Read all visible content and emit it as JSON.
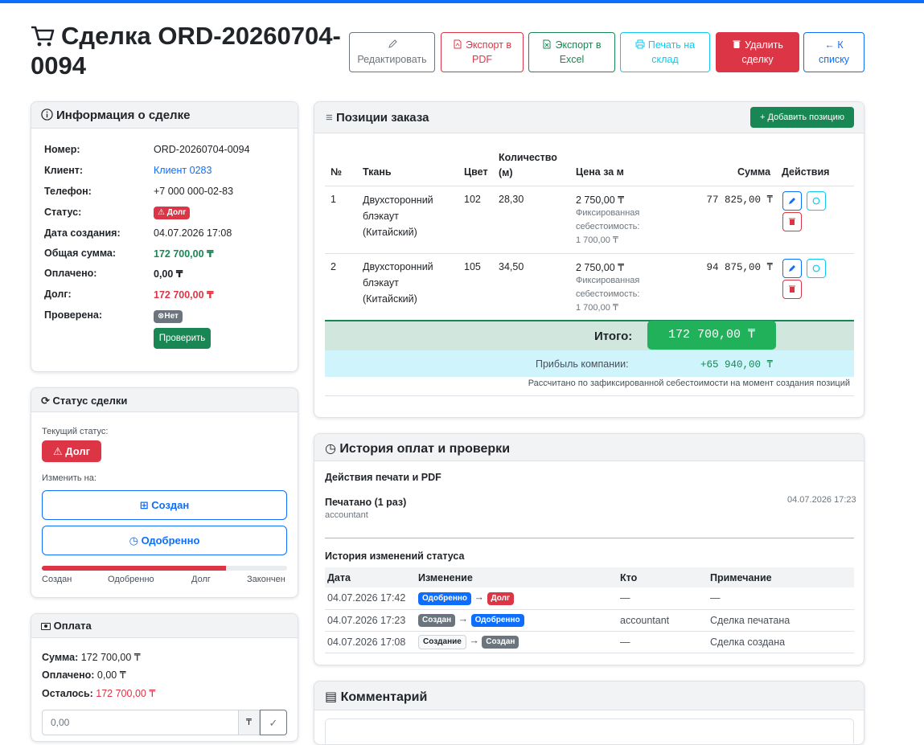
{
  "header": {
    "title": "Сделка ORD-20260704-0094",
    "buttons": {
      "edit": "Редактировать",
      "export_pdf": "Экспорт в PDF",
      "export_excel": "Экспорт в Excel",
      "print_warehouse": "Печать на склад",
      "delete": "Удалить сделку",
      "back": "К списку"
    }
  },
  "info": {
    "title": "Информация о сделке",
    "rows": {
      "number": {
        "label": "Номер:",
        "value": "ORD-20260704-0094"
      },
      "client": {
        "label": "Клиент:",
        "value": "Клиент 0283"
      },
      "phone": {
        "label": "Телефон:",
        "value": "+7 000 000-02-83"
      },
      "status": {
        "label": "Статус:",
        "value": "Долг"
      },
      "created": {
        "label": "Дата создания:",
        "value": "04.07.2026 17:08"
      },
      "total": {
        "label": "Общая сумма:",
        "value": "172 700,00 ₸"
      },
      "paid": {
        "label": "Оплачено:",
        "value": "0,00 ₸"
      },
      "debt": {
        "label": "Долг:",
        "value": "172 700,00 ₸"
      },
      "verified": {
        "label": "Проверена:",
        "value": "Нет"
      }
    },
    "verify_button": "Проверить"
  },
  "status_card": {
    "title": "Статус сделки",
    "current_label": "Текущий статус:",
    "current_value": "Долг",
    "change_label": "Изменить на:",
    "options": [
      "Создан",
      "Одобренно"
    ],
    "progress": 0.75,
    "steps": [
      "Создан",
      "Одобренно",
      "Долг",
      "Закончен"
    ]
  },
  "payment": {
    "title": "Оплата",
    "sum_label": "Сумма:",
    "sum_value": "172 700,00 ₸",
    "paid_label": "Оплачено:",
    "paid_value": "0,00 ₸",
    "left_label": "Осталось:",
    "left_value": "172 700,00 ₸",
    "input_placeholder": "0,00",
    "currency_symbol": "₸"
  },
  "items": {
    "title": "Позиции заказа",
    "add_button": "Добавить позицию",
    "columns": {
      "num": "№",
      "fabric": "Ткань",
      "color": "Цвет",
      "qty": "Количество (м)",
      "price": "Цена за м",
      "sum": "Сумма",
      "actions": "Действия"
    },
    "rows": [
      {
        "num": "1",
        "fabric": "Двухсторонний блэкаут (Китайский)",
        "color": "102",
        "qty": "28,30",
        "price": "2 750,00 ₸",
        "cost_note": "Фиксированная себестоимость:",
        "cost": "1 700,00 ₸",
        "sum": "77 825,00 ₸"
      },
      {
        "num": "2",
        "fabric": "Двухсторонний блэкаут (Китайский)",
        "color": "105",
        "qty": "34,50",
        "price": "2 750,00 ₸",
        "cost_note": "Фиксированная себестоимость:",
        "cost": "1 700,00 ₸",
        "sum": "94 875,00 ₸"
      }
    ],
    "total_label": "Итого:",
    "total_value": "172 700,00 ₸",
    "profit_label": "Прибыль компании:",
    "profit_value": "+65 940,00 ₸",
    "footnote": "Рассчитано по зафиксированной себестоимости на момент создания позиций"
  },
  "history": {
    "title": "История оплат и проверки",
    "print_section": "Действия печати и PDF",
    "print_entry": "Печатано (1 раз)",
    "print_user": "accountant",
    "print_date": "04.07.2026 17:23",
    "status_section": "История изменений статуса",
    "columns": {
      "date": "Дата",
      "change": "Изменение",
      "who": "Кто",
      "note": "Примечание"
    },
    "rows": [
      {
        "date": "04.07.2026 17:42",
        "from": "Одобренно",
        "to": "Долг",
        "who": "—",
        "note": "—"
      },
      {
        "date": "04.07.2026 17:23",
        "from": "Создан",
        "to": "Одобренно",
        "who": "accountant",
        "note": "Сделка печатана"
      },
      {
        "date": "04.07.2026 17:08",
        "from": "Создание",
        "to": "Создан",
        "who": "—",
        "note": "Сделка создана"
      }
    ]
  },
  "comment": {
    "title": "Комментарий"
  }
}
